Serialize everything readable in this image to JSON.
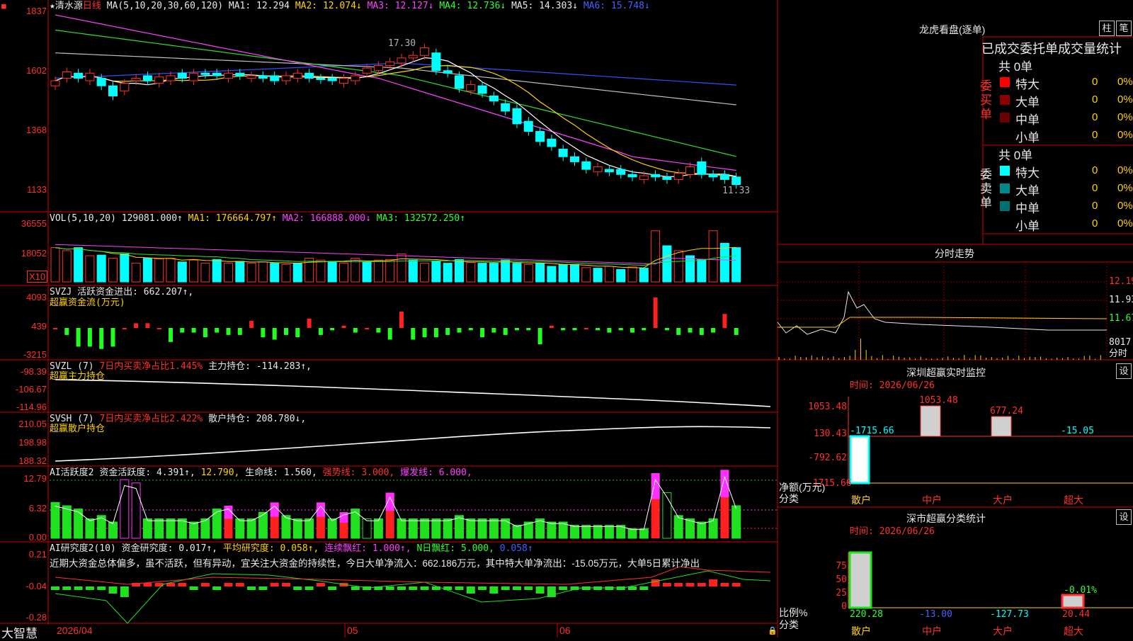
{
  "price_header": {
    "star": "★",
    "name": "清水源",
    "period": "日线",
    "ma_spec": "MA(5,10,20,30,60,120)",
    "ma1": "MA1: 12.294",
    "ma2": "MA2: 12.074↓",
    "ma3": "MA3: 12.127↓",
    "ma4": "MA4: 12.736↓",
    "ma5": "MA5: 14.303↓",
    "ma6": "MA6: 15.748↓"
  },
  "price_axis": [
    "1837",
    "1602",
    "1368",
    "1133"
  ],
  "price_annotations": {
    "high": "17.30",
    "low": "11.33"
  },
  "vol_header": {
    "name": "VOL(5,10,20)",
    "v": "129081.000↑",
    "ma1": "MA1: 176664.797↑",
    "ma2": "MA2: 166888.000↓",
    "ma3": "MA3: 132572.250↑"
  },
  "vol_axis": [
    "36555",
    "18052"
  ],
  "vol_unit": "X10",
  "svzj_header": {
    "name": "SVZJ",
    "label": "活跃资金进出: 662.207↑,",
    "sub": "超赢资金流(万元)"
  },
  "svzj_axis": [
    "4093",
    "439",
    "-3215"
  ],
  "svzl_header": {
    "name": "SVZL (7)",
    "label": "7日内买卖净占比1.445%",
    "holding": "主力持仓: -114.283↑,",
    "sub": "超赢主力持仓"
  },
  "svzl_axis": [
    "-98.39",
    "-106.67",
    "-114.96"
  ],
  "svsh_header": {
    "name": "SVSH (7)",
    "label": "7日内买卖净占比2.422%",
    "holding": "散户持仓: 208.780↓,",
    "sub": "超赢散户持仓"
  },
  "svsh_axis": [
    "210.05",
    "198.98",
    "188.32"
  ],
  "ai1_header": {
    "name": "AI活跃度2",
    "a": "资金活跃度: 4.391↑,",
    "b": "12.790,",
    "c": "生命线: 1.560,",
    "d": "强势线: 3.000,",
    "e": "爆发线: 6.000,"
  },
  "ai1_axis": [
    "12.79",
    "6.32",
    "0.00"
  ],
  "ai2_header": {
    "name": "AI研究度2(10)",
    "a": "资金研究度: 0.017↑,",
    "b": "平均研究度: 0.058↑,",
    "c": "连续飘红: 1.000↑,",
    "d": "N日飘红: 5.000,",
    "e": "0.058↑"
  },
  "ai2_text": "近期大资金总体偏多，虽不活跃，但有异动，宜关注大资金的持续性，今日大单净流入：662.186万元，其中特大单净流出：-15.05万元，大单5日累计净出",
  "ai2_axis": [
    "0.21",
    "-0.04",
    "-0.28"
  ],
  "bottom": {
    "brand": "大智慧",
    "date": "2026/04",
    "m5": "05",
    "m6": "06"
  },
  "dragon": {
    "title": "龙虎看盘(逐单)",
    "btn1": "柱",
    "btn2": "笔",
    "heading": "已成交委托单成交量统计",
    "buy_label": "委买单",
    "sell_label": "委卖单",
    "buy_total": "共 0单",
    "sell_total": "共 0单",
    "rows": [
      {
        "name": "特大",
        "count": "0",
        "pct": "0%"
      },
      {
        "name": "大单",
        "count": "0",
        "pct": "0%"
      },
      {
        "name": "中单",
        "count": "0",
        "pct": "0%"
      },
      {
        "name": "小单",
        "count": "0",
        "pct": "0%"
      }
    ],
    "buy_colors": [
      "#ff0000",
      "#8b0000",
      "#6a0000",
      ""
    ],
    "sell_colors": [
      "#00ffff",
      "#008b8b",
      "#007070",
      ""
    ]
  },
  "minute": {
    "title": "分时走势",
    "axis": [
      "12.19",
      "11.93",
      "11.67",
      "8017",
      "分时"
    ]
  },
  "sz_monitor": {
    "title": "深圳超赢实时监控",
    "btn": "设",
    "time": "时间: 2026/06/26",
    "axis": [
      "1053.48",
      "130.43",
      "-792.62",
      "-1715.66"
    ],
    "vals": {
      "retail": "-1715.66",
      "mid": "1053.48",
      "large": "677.24",
      "xl": "-15.05"
    },
    "ylabel": "净额(万元)",
    "xlabel": "分类",
    "cats": [
      "散户",
      "中户",
      "大户",
      "超大"
    ]
  },
  "sz_class": {
    "title": "深市超赢分类统计",
    "btn": "设",
    "time": "时间: 2026/06/26",
    "axis": [
      "75",
      "50",
      "25",
      "0"
    ],
    "vals": {
      "retail": "220.28",
      "mid": "-13.00",
      "large": "-127.73",
      "xl": "20.44",
      "top": "-0.01%"
    },
    "ylabel": "比例%",
    "xlabel": "分类",
    "cats": [
      "散户",
      "中户",
      "大户",
      "超大"
    ]
  }
}
